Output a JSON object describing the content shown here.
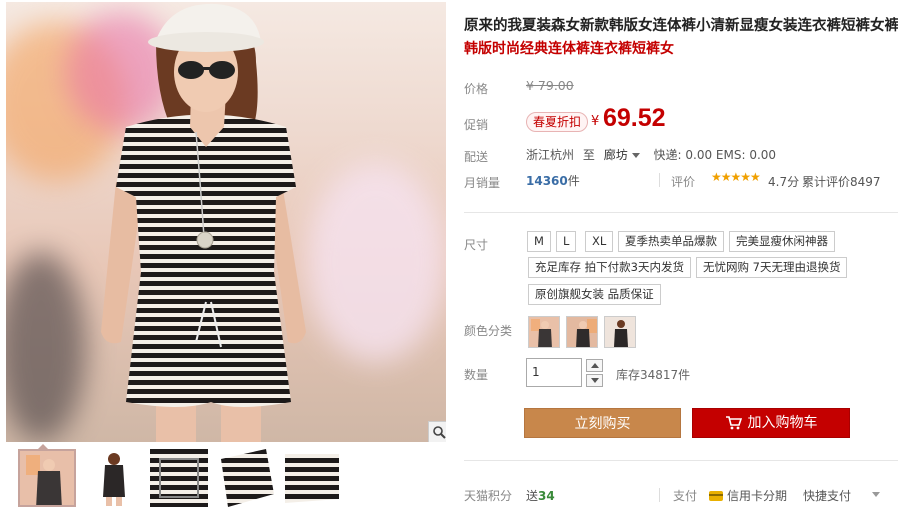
{
  "product": {
    "title_line1": "原来的我夏装森女新款韩版女连体裤小清新显瘦女装连衣裤短裤女裤",
    "title_line2": "韩版时尚经典连体裤连衣裤短裤女"
  },
  "price": {
    "label": "价格",
    "original": "¥ 79.00"
  },
  "promo": {
    "label": "促销",
    "badge": "春夏折扣",
    "currency": "¥",
    "price": "69.52"
  },
  "shipping": {
    "label": "配送",
    "origin": "浙江杭州",
    "to": "至",
    "destination": "廊坊",
    "fees": "快递: 0.00 EMS: 0.00"
  },
  "sales": {
    "label": "月销量",
    "count": "14360",
    "unit": "件",
    "rating_label": "评价",
    "stars": "★★★★★",
    "score": "4.7分",
    "reviews": "累计评价8497"
  },
  "size": {
    "label": "尺寸",
    "options": [
      "M",
      "L",
      "XL",
      "夏季热卖单品爆款",
      "完美显瘦休闲神器",
      "充足库存 拍下付款3天内发货",
      "无忧网购 7天无理由退换货",
      "原创旗舰女装 品质保证"
    ]
  },
  "color": {
    "label": "颜色分类",
    "swatch_count": 3
  },
  "quantity": {
    "label": "数量",
    "value": "1",
    "stock": "库存34817件"
  },
  "buttons": {
    "buy_now": "立刻购买",
    "add_cart": "加入购物车"
  },
  "footer": {
    "points_label": "天猫积分",
    "points_prefix": "送",
    "points_value": "34",
    "pay_label": "支付",
    "credit_card": "信用卡分期",
    "quick_pay": "快捷支付"
  },
  "colors": {
    "accent_red": "#c40000",
    "buy_orange": "#c8874b",
    "link_blue": "#3a6da6",
    "star_gold": "#f0a000"
  }
}
